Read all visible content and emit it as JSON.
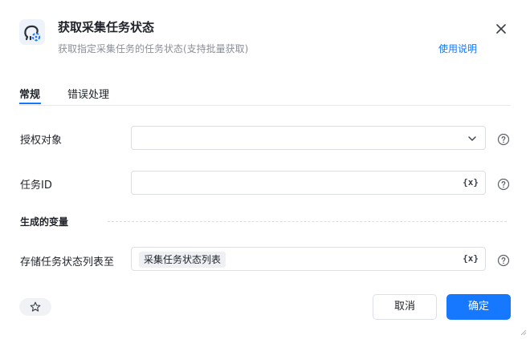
{
  "header": {
    "title": "获取采集任务状态",
    "subtitle": "获取指定采集任务的任务状态(支持批量获取)",
    "help_link": "使用说明"
  },
  "tabs": [
    {
      "label": "常规",
      "active": true
    },
    {
      "label": "错误处理",
      "active": false
    }
  ],
  "form": {
    "auth_object": {
      "label": "授权对象",
      "value": ""
    },
    "task_id": {
      "label": "任务ID",
      "value": "",
      "var_icon": "{x}"
    },
    "section_output": "生成的变量",
    "store_list": {
      "label": "存储任务状态列表至",
      "tag": "采集任务状态列表",
      "var_icon": "{x}"
    }
  },
  "footer": {
    "cancel_label": "取消",
    "ok_label": "确定"
  },
  "colors": {
    "accent": "#1677ff",
    "text": "#1f2329",
    "muted": "#8a8f99",
    "border": "#dcdfe6"
  },
  "icons": [
    "app-icon",
    "close-icon",
    "chevron-down-icon",
    "variable-icon",
    "help-circle-icon",
    "star-icon",
    "resize-grip-icon"
  ]
}
